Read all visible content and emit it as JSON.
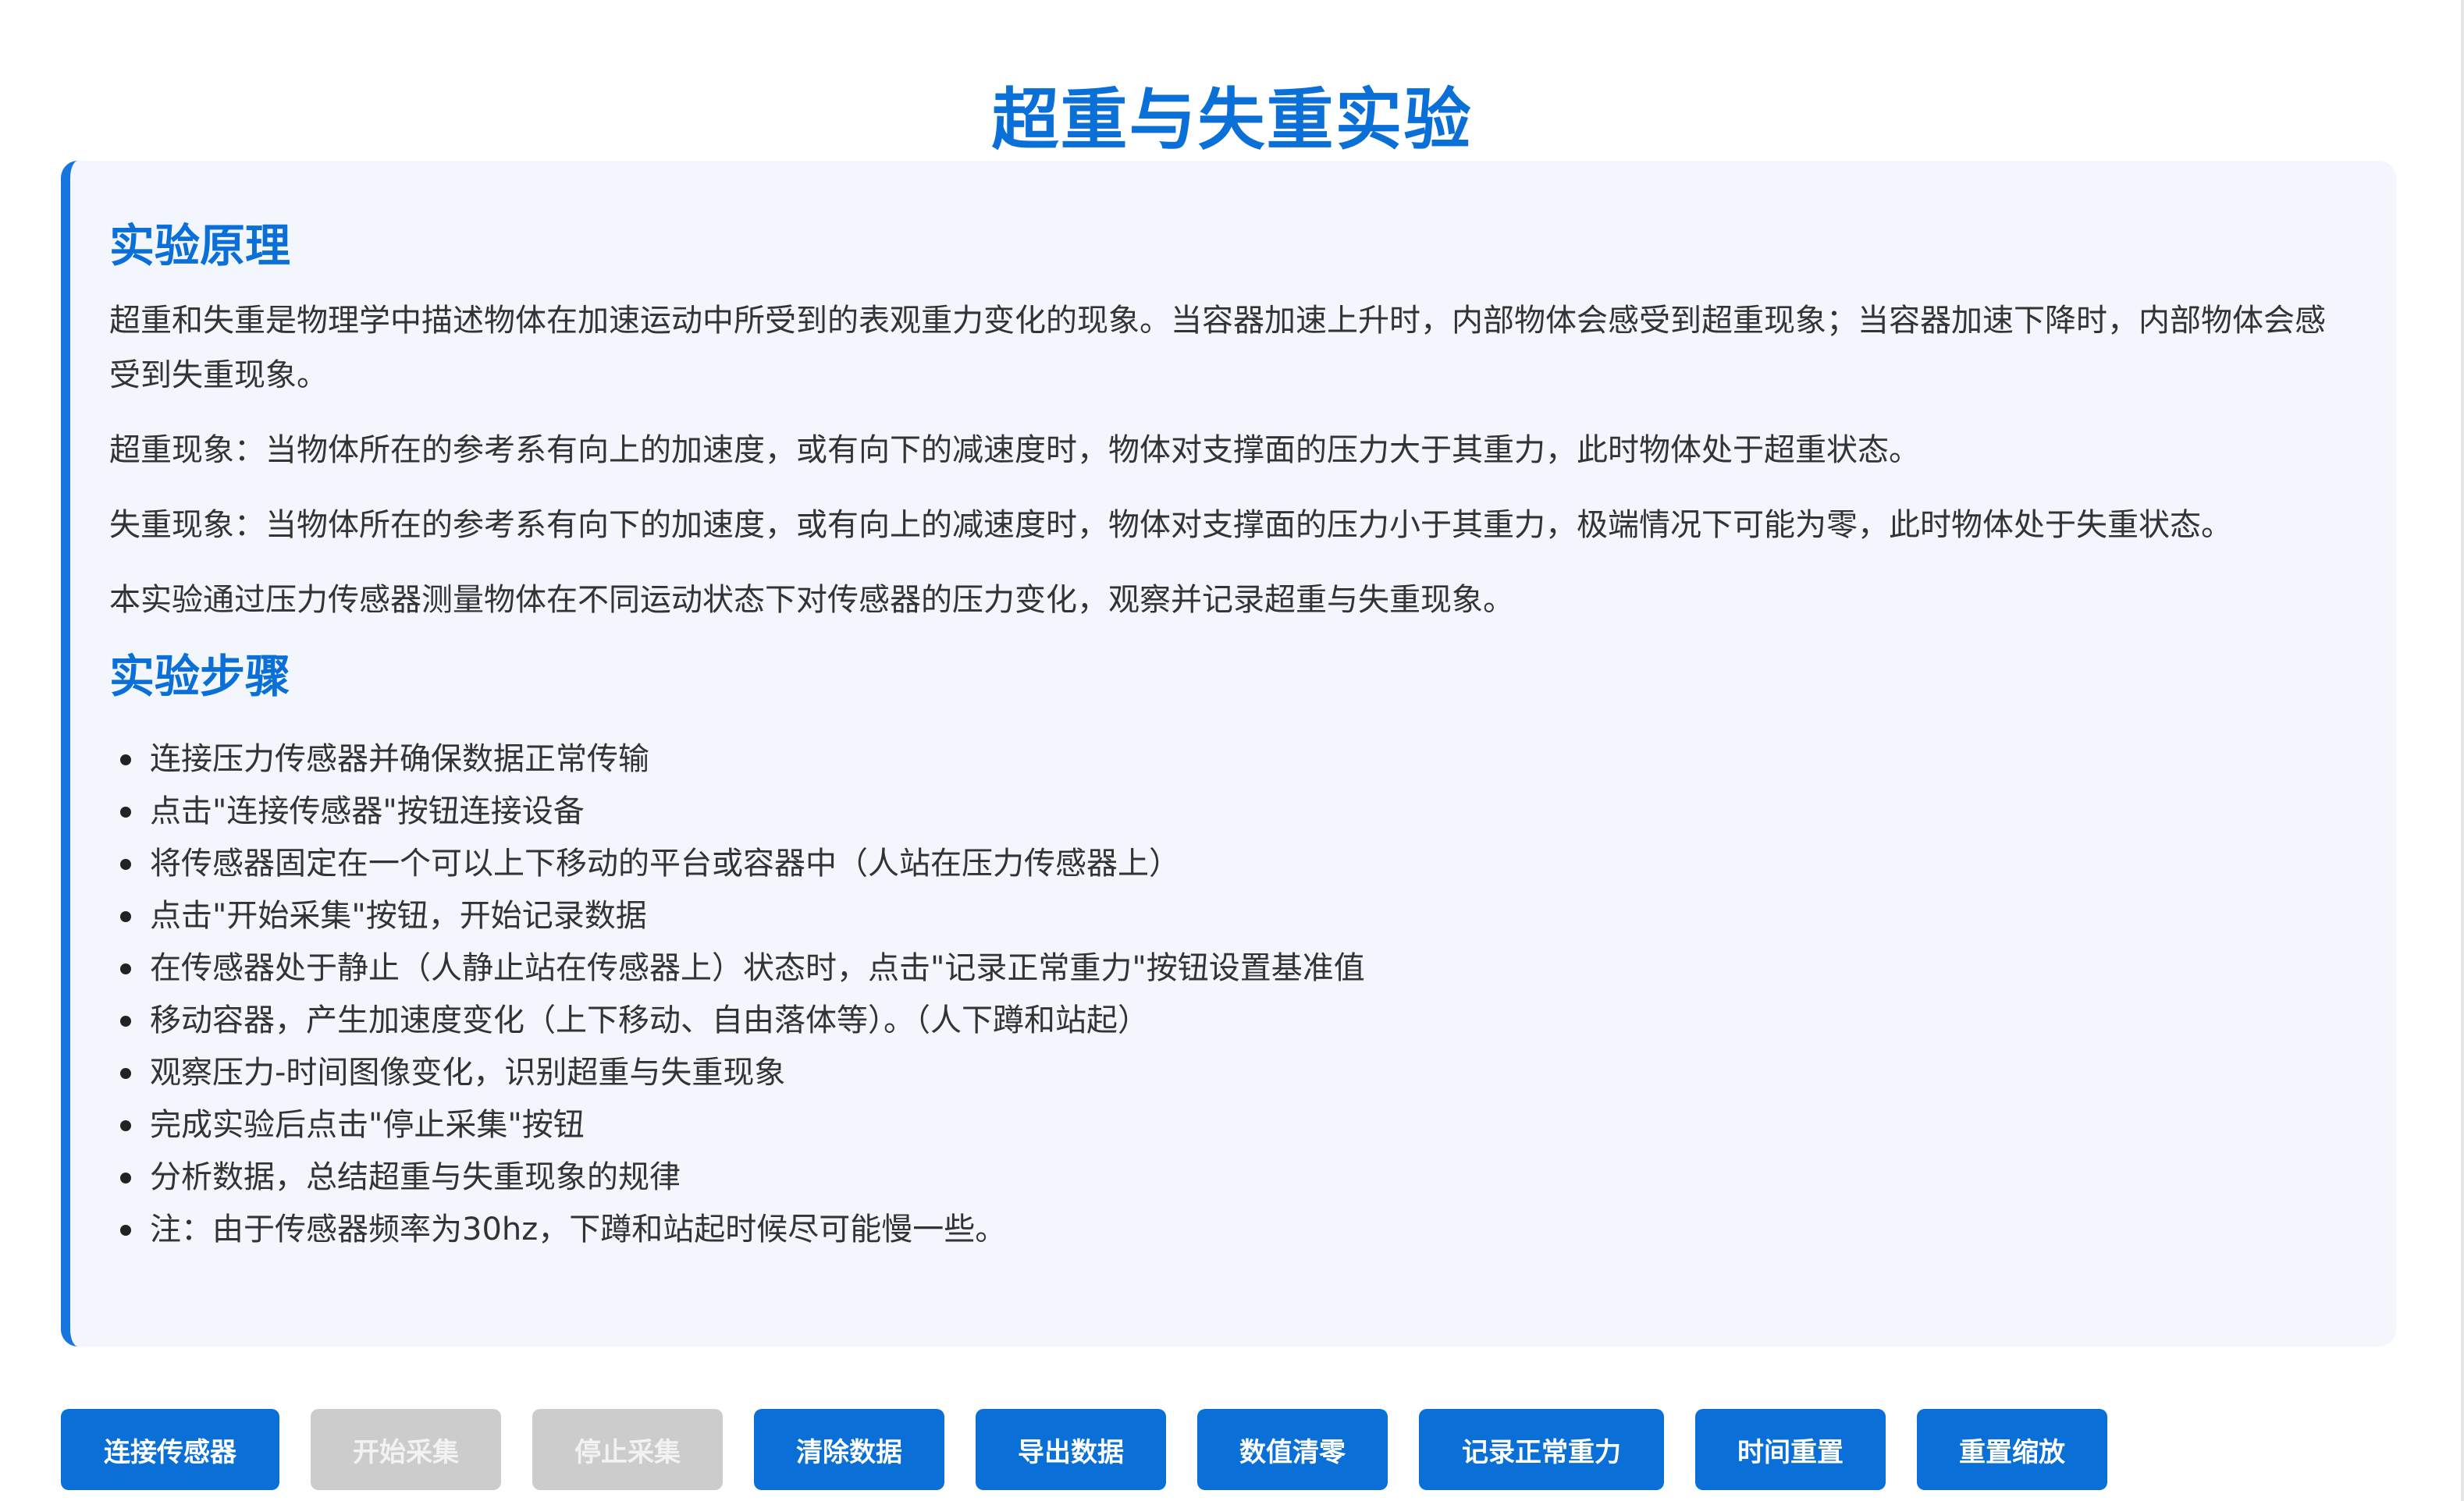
{
  "title": "超重与失重实验",
  "principle": {
    "heading": "实验原理",
    "paragraphs": [
      "超重和失重是物理学中描述物体在加速运动中所受到的表观重力变化的现象。当容器加速上升时，内部物体会感受到超重现象；当容器加速下降时，内部物体会感受到失重现象。",
      "超重现象：当物体所在的参考系有向上的加速度，或有向下的减速度时，物体对支撑面的压力大于其重力，此时物体处于超重状态。",
      "失重现象：当物体所在的参考系有向下的加速度，或有向上的减速度时，物体对支撑面的压力小于其重力，极端情况下可能为零，此时物体处于失重状态。",
      "本实验通过压力传感器测量物体在不同运动状态下对传感器的压力变化，观察并记录超重与失重现象。"
    ]
  },
  "steps": {
    "heading": "实验步骤",
    "items": [
      "连接压力传感器并确保数据正常传输",
      "点击\"连接传感器\"按钮连接设备",
      "将传感器固定在一个可以上下移动的平台或容器中（人站在压力传感器上）",
      "点击\"开始采集\"按钮，开始记录数据",
      "在传感器处于静止（人静止站在传感器上）状态时，点击\"记录正常重力\"按钮设置基准值",
      "移动容器，产生加速度变化（上下移动、自由落体等）。（人下蹲和站起）",
      "观察压力-时间图像变化，识别超重与失重现象",
      "完成实验后点击\"停止采集\"按钮",
      "分析数据，总结超重与失重现象的规律",
      "注：由于传感器频率为30hz，下蹲和站起时候尽可能慢一些。"
    ]
  },
  "buttons": [
    {
      "label": "连接传感器",
      "enabled": true
    },
    {
      "label": "开始采集",
      "enabled": false
    },
    {
      "label": "停止采集",
      "enabled": false
    },
    {
      "label": "清除数据",
      "enabled": true
    },
    {
      "label": "导出数据",
      "enabled": true
    },
    {
      "label": "数值清零",
      "enabled": true
    },
    {
      "label": "记录正常重力",
      "enabled": true
    },
    {
      "label": "时间重置",
      "enabled": true
    },
    {
      "label": "重置缩放",
      "enabled": true
    }
  ],
  "colors": {
    "accent": "#0a6fd6",
    "card_background": "#f3f7fd",
    "card_border": "#1775e0",
    "button_disabled": "#cccccc",
    "text": "#333333"
  }
}
